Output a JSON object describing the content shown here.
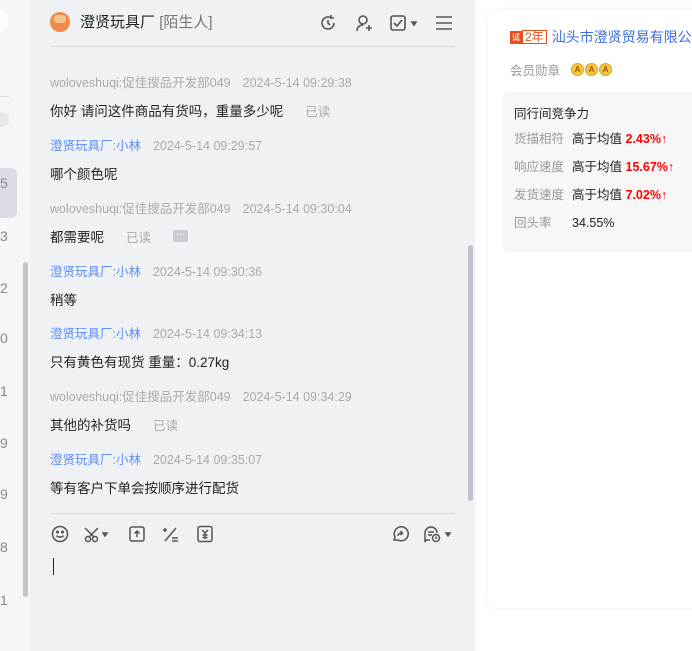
{
  "sidebar": {
    "numbers": [
      "5",
      "3",
      "2",
      "0",
      "1",
      "9",
      "9",
      "8",
      "1"
    ]
  },
  "chat": {
    "contact_name": "澄贤玩具厂",
    "contact_tag": "[陌生人]",
    "messages": [
      {
        "sender": "woloveshuqi:促佳搜品开发部049",
        "time": "2024-5-14 09:29:38",
        "text": "你好 请问这件商品有货吗，重量多少呢",
        "status": "已读",
        "self": true
      },
      {
        "sender": "澄贤玩具厂:小林",
        "time": "2024-5-14 09:29:57",
        "text": "哪个颜色呢",
        "self": false
      },
      {
        "sender": "woloveshuqi:促佳搜品开发部049",
        "time": "2024-5-14 09:30:04",
        "text": "都需要呢",
        "status": "已读",
        "more": "···",
        "self": true
      },
      {
        "sender": "澄贤玩具厂:小林",
        "time": "2024-5-14 09:30:36",
        "text": "稍等",
        "self": false
      },
      {
        "sender": "澄贤玩具厂:小林",
        "time": "2024-5-14 09:34:13",
        "text": "只有黄色有现货 重量：0.27kg",
        "self": false
      },
      {
        "sender": "woloveshuqi:促佳搜品开发部049",
        "time": "2024-5-14 09:34:29",
        "text": "其他的补货吗",
        "status": "已读",
        "self": true
      },
      {
        "sender": "澄贤玩具厂:小林",
        "time": "2024-5-14 09:35:07",
        "text": "等有客户下单会按顺序进行配货",
        "self": false
      }
    ],
    "input_value": ""
  },
  "shop": {
    "badge": "诚",
    "years": "2年",
    "company": "汕头市澄贤贸易有限公",
    "medal_label": "会员勋章",
    "medal_icon": "A",
    "competition": {
      "title": "同行间竞争力",
      "rows": [
        {
          "label": "货描相符",
          "desc": "高于均值",
          "value": "2.43%",
          "arrow": "↑"
        },
        {
          "label": "响应速度",
          "desc": "高于均值",
          "value": "15.67%",
          "arrow": "↑"
        },
        {
          "label": "发货速度",
          "desc": "高于均值",
          "value": "7.02%",
          "arrow": "↑"
        },
        {
          "label": "回头率",
          "desc": "34.55%"
        }
      ]
    }
  },
  "colors": {
    "accent_blue": "#5b8ff9",
    "highlight_red": "#ff0000",
    "badge_orange": "#e94e1b"
  }
}
